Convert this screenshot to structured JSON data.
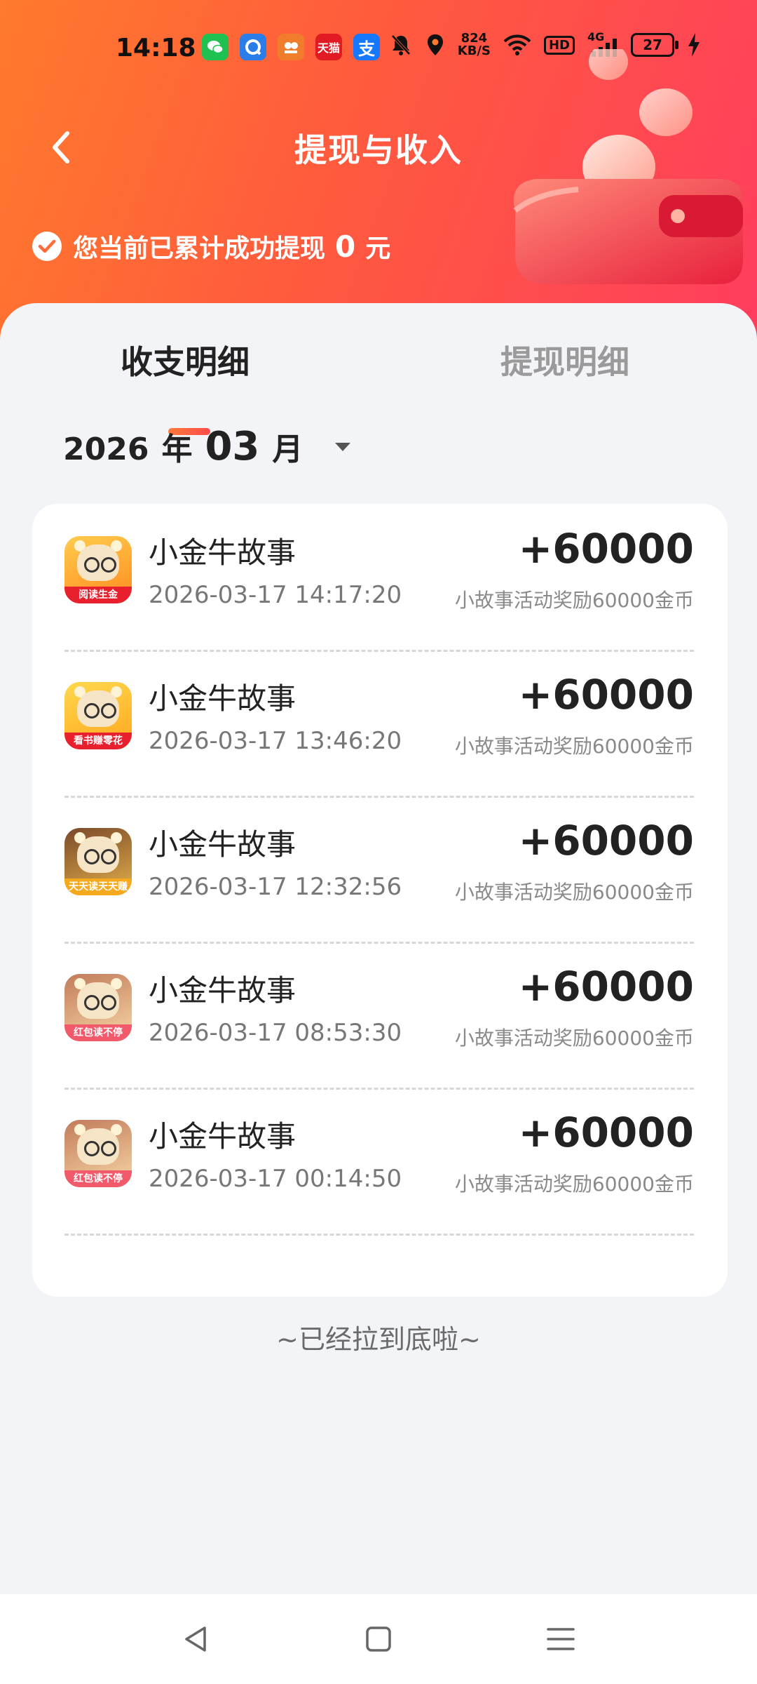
{
  "status_bar": {
    "time": "14:18",
    "network_speed_value": "824",
    "network_speed_unit": "KB/S",
    "hd_label": "HD",
    "signal_label": "4G",
    "battery_level": "27",
    "app_icons": [
      {
        "name": "wechat-icon",
        "color": "#1fc251"
      },
      {
        "name": "browser-icon",
        "color": "#2b7de9"
      },
      {
        "name": "shopping-icon",
        "color": "#f07d2c"
      },
      {
        "name": "tmall-icon",
        "label": "天猫",
        "color": "#e21a23"
      },
      {
        "name": "alipay-icon",
        "label": "支",
        "color": "#1677ff"
      }
    ]
  },
  "header": {
    "title": "提现与收入",
    "summary_prefix": "您当前已累计成功提现",
    "summary_amount": "0",
    "summary_unit": "元"
  },
  "tabs": [
    {
      "label": "收支明细",
      "active": true
    },
    {
      "label": "提现明细",
      "active": false
    }
  ],
  "month_picker": {
    "year": "2026",
    "year_unit": "年",
    "month": "03",
    "month_unit": "月"
  },
  "records": [
    {
      "app_name": "小金牛故事",
      "datetime": "2026-03-17 14:17:20",
      "amount": "+60000",
      "description": "小故事活动奖励60000金币",
      "icon_badge": "阅读生金"
    },
    {
      "app_name": "小金牛故事",
      "datetime": "2026-03-17 13:46:20",
      "amount": "+60000",
      "description": "小故事活动奖励60000金币",
      "icon_badge": "看书赚零花"
    },
    {
      "app_name": "小金牛故事",
      "datetime": "2026-03-17 12:32:56",
      "amount": "+60000",
      "description": "小故事活动奖励60000金币",
      "icon_badge": "天天读天天赚"
    },
    {
      "app_name": "小金牛故事",
      "datetime": "2026-03-17 08:53:30",
      "amount": "+60000",
      "description": "小故事活动奖励60000金币",
      "icon_badge": "红包读不停"
    },
    {
      "app_name": "小金牛故事",
      "datetime": "2026-03-17 00:14:50",
      "amount": "+60000",
      "description": "小故事活动奖励60000金币",
      "icon_badge": "红包读不停"
    }
  ],
  "footer_text": "~已经拉到底啦~",
  "colors": {
    "header_gradient_start": "#ff7a2c",
    "header_gradient_end": "#ff3d5f",
    "tab_underline": "#ff5a3e",
    "page_background": "#f3f4f8"
  }
}
